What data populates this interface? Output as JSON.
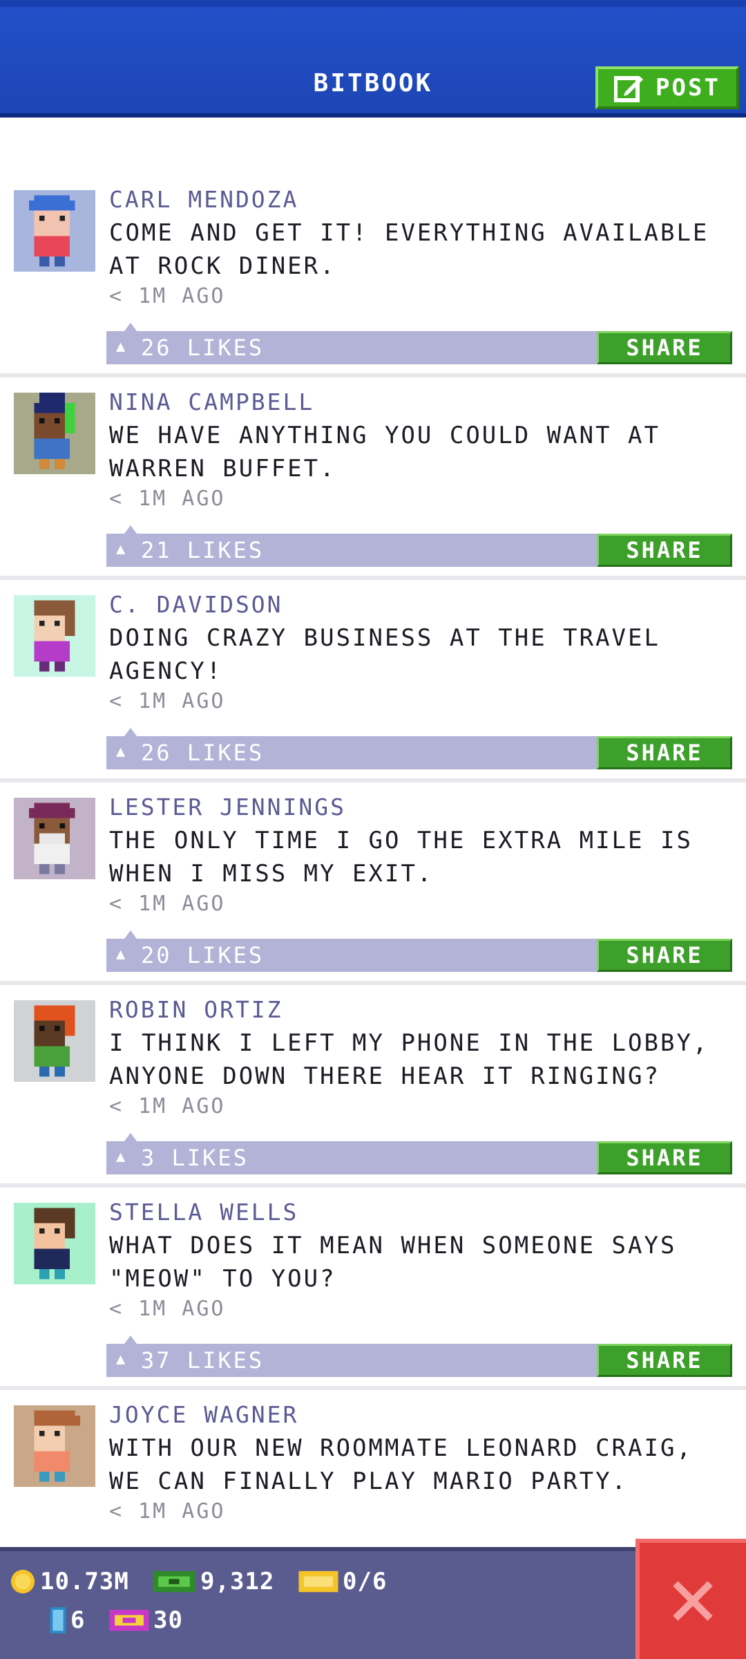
{
  "header": {
    "title": "BITBOOK",
    "post_label": "POST"
  },
  "posts": [
    {
      "name": "CARL MENDOZA",
      "message": "COME AND GET IT! EVERYTHING AVAILABLE AT ROCK DINER.",
      "time": "< 1M AGO",
      "likes": "26 LIKES",
      "share": "SHARE"
    },
    {
      "name": "NINA CAMPBELL",
      "message": "WE HAVE ANYTHING YOU COULD WANT AT WARREN BUFFET.",
      "time": "< 1M AGO",
      "likes": "21 LIKES",
      "share": "SHARE"
    },
    {
      "name": "C. DAVIDSON",
      "message": "DOING CRAZY BUSINESS AT THE TRAVEL AGENCY!",
      "time": "< 1M AGO",
      "likes": "26 LIKES",
      "share": "SHARE"
    },
    {
      "name": "LESTER JENNINGS",
      "message": "THE ONLY TIME I GO THE EXTRA MILE IS WHEN I MISS MY EXIT.",
      "time": "< 1M AGO",
      "likes": "20 LIKES",
      "share": "SHARE"
    },
    {
      "name": "ROBIN ORTIZ",
      "message": "I THINK I LEFT MY PHONE IN THE LOBBY, ANYONE DOWN THERE HEAR IT RINGING?",
      "time": "< 1M AGO",
      "likes": "3 LIKES",
      "share": "SHARE"
    },
    {
      "name": "STELLA WELLS",
      "message": "WHAT DOES IT MEAN WHEN SOMEONE SAYS \"MEOW\" TO YOU?",
      "time": "< 1M AGO",
      "likes": "37 LIKES",
      "share": "SHARE"
    },
    {
      "name": "JOYCE WAGNER",
      "message": "WITH OUR NEW ROOMMATE LEONARD CRAIG, WE CAN FINALLY PLAY MARIO PARTY.",
      "time": "< 1M AGO"
    }
  ],
  "status": {
    "coins": "10.73M",
    "bux": "9,312",
    "tickets": "0/6",
    "elevator": "6",
    "vip": "30"
  },
  "colors": {
    "header_blue": "#1d45b5",
    "share_green": "#3da02a",
    "likes_bar": "#b3b3d7",
    "name_purple": "#5b5a94",
    "close_red": "#e03a3a",
    "status_bar": "#5a5c8f"
  },
  "icons": {
    "post": "edit-icon",
    "like": "thumbs-up-icon",
    "close": "close-icon",
    "coins": "coin-icon",
    "bux": "bux-icon",
    "tickets": "ticket-icon",
    "elevator": "elevator-icon",
    "vip": "vip-ticket-icon"
  }
}
